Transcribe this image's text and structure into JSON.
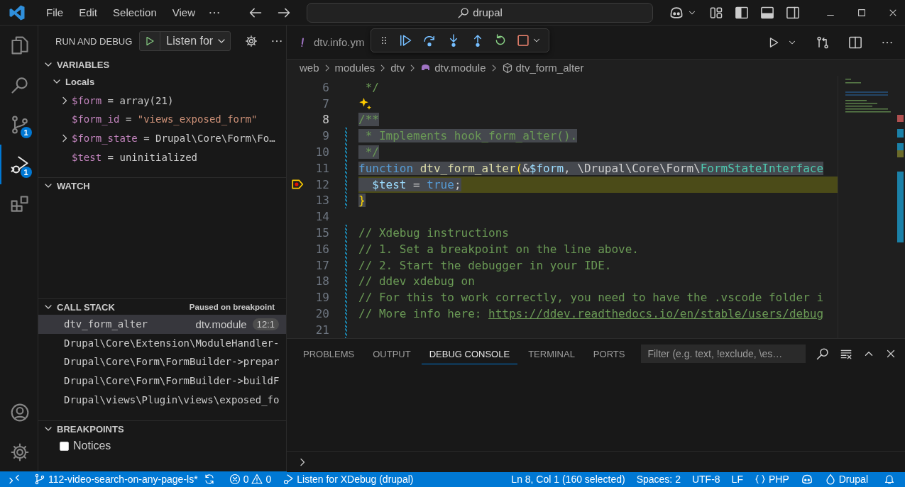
{
  "title_bar": {
    "menus": [
      "File",
      "Edit",
      "Selection",
      "View"
    ],
    "command_center": "drupal"
  },
  "activity_bar": {
    "items": [
      {
        "kind": "explorer",
        "selected": false
      },
      {
        "kind": "search",
        "selected": false
      },
      {
        "kind": "source-control",
        "selected": false,
        "badge": "1"
      },
      {
        "kind": "run-debug",
        "selected": true,
        "badge": "1"
      },
      {
        "kind": "extensions",
        "selected": false
      }
    ],
    "bottom": [
      {
        "kind": "account"
      },
      {
        "kind": "manage"
      }
    ]
  },
  "sidebar": {
    "title": "RUN AND DEBUG",
    "config": "Listen for",
    "variables": {
      "title": "VARIABLES",
      "expanded": true,
      "scope": "Locals",
      "vars": [
        {
          "name": "$form",
          "op": "=",
          "value": "array(21)",
          "expandable": true,
          "kind": "plain"
        },
        {
          "name": "$form_id",
          "op": "=",
          "value": "\"views_exposed_form\"",
          "expandable": false,
          "kind": "string"
        },
        {
          "name": "$form_state",
          "op": "=",
          "value": "Drupal\\Core\\Form\\Fo…",
          "expandable": true,
          "kind": "plain"
        },
        {
          "name": "$test",
          "op": "=",
          "value": "uninitialized",
          "expandable": false,
          "kind": "plain"
        }
      ]
    },
    "watch": {
      "title": "WATCH",
      "expanded": true
    },
    "call_stack": {
      "title": "CALL STACK",
      "status": "Paused on breakpoint",
      "frames": [
        {
          "name": "dtv_form_alter",
          "file": "dtv.module",
          "position": "12:1",
          "selected": true
        },
        {
          "name": "Drupal\\Core\\Extension\\ModuleHandler-",
          "selected": false
        },
        {
          "name": "Drupal\\Core\\Form\\FormBuilder->prepar",
          "selected": false
        },
        {
          "name": "Drupal\\Core\\Form\\FormBuilder->buildF",
          "selected": false
        },
        {
          "name": "Drupal\\views\\Plugin\\views\\exposed_fo",
          "selected": false
        }
      ]
    },
    "breakpoints": {
      "title": "BREAKPOINTS",
      "items": [
        {
          "label": "Notices",
          "checked": false
        }
      ]
    }
  },
  "editor": {
    "tabs": [
      {
        "label": "dtv.info.ym",
        "selected": false
      }
    ],
    "breadcrumbs": [
      {
        "label": "web",
        "kind": "folder"
      },
      {
        "label": "modules",
        "kind": "folder"
      },
      {
        "label": "dtv",
        "kind": "folder"
      },
      {
        "label": "dtv.module",
        "kind": "file"
      },
      {
        "label": "dtv_form_alter",
        "kind": "function"
      }
    ],
    "lines": [
      {
        "number": "6",
        "tokens": [
          {
            "t": " */",
            "kind": "comment"
          }
        ],
        "selected": false,
        "cursor": false,
        "modified": false,
        "paused": false,
        "hint": false
      },
      {
        "number": "7",
        "selected": false,
        "cursor": false,
        "modified": false,
        "paused": false,
        "hint": true
      },
      {
        "number": "8",
        "tokens": [
          {
            "t": "/**",
            "kind": "comment"
          }
        ],
        "selected": true,
        "cursor": true,
        "modified": false,
        "paused": false,
        "hint": false
      },
      {
        "number": "9",
        "tokens": [
          {
            "t": " * Implements hook_form_alter().",
            "kind": "comment"
          }
        ],
        "selected": true,
        "cursor": false,
        "modified": true,
        "paused": false,
        "hint": false
      },
      {
        "number": "10",
        "tokens": [
          {
            "t": " */",
            "kind": "comment"
          }
        ],
        "selected": true,
        "cursor": false,
        "modified": true,
        "paused": false,
        "hint": false
      },
      {
        "number": "11",
        "tokens": [
          {
            "t": "function ",
            "kind": "keyword"
          },
          {
            "t": "dtv_form_alter",
            "kind": "func"
          },
          {
            "t": "(",
            "kind": "bracket"
          },
          {
            "t": "&",
            "kind": "plain"
          },
          {
            "t": "$form",
            "kind": "var"
          },
          {
            "t": ", \\Drupal\\Core\\Form\\",
            "kind": "plain"
          },
          {
            "t": "FormStateInterface",
            "kind": "type"
          }
        ],
        "selected": true,
        "cursor": false,
        "modified": true,
        "paused": false,
        "hint": false
      },
      {
        "number": "12",
        "tokens": [
          {
            "t": "  $test",
            "kind": "var"
          },
          {
            "t": " = ",
            "kind": "plain"
          },
          {
            "t": "true",
            "kind": "keyword"
          },
          {
            "t": ";",
            "kind": "plain"
          }
        ],
        "selected": true,
        "cursor": false,
        "modified": true,
        "paused": true,
        "hint": false
      },
      {
        "number": "13",
        "tokens": [
          {
            "t": "}",
            "kind": "bracket"
          }
        ],
        "selected": true,
        "cursor": false,
        "modified": true,
        "paused": false,
        "hint": false
      },
      {
        "number": "14",
        "selected": false,
        "cursor": false,
        "modified": false,
        "paused": false,
        "hint": false
      },
      {
        "number": "15",
        "tokens": [
          {
            "t": "// Xdebug instructions",
            "kind": "comment"
          }
        ],
        "selected": false,
        "cursor": false,
        "modified": true,
        "paused": false,
        "hint": false
      },
      {
        "number": "16",
        "tokens": [
          {
            "t": "// 1. Set a breakpoint on the line above.",
            "kind": "comment"
          }
        ],
        "selected": false,
        "cursor": false,
        "modified": true,
        "paused": false,
        "hint": false
      },
      {
        "number": "17",
        "tokens": [
          {
            "t": "// 2. Start the debugger in your IDE.",
            "kind": "comment"
          }
        ],
        "selected": false,
        "cursor": false,
        "modified": true,
        "paused": false,
        "hint": false
      },
      {
        "number": "18",
        "tokens": [
          {
            "t": "// ddev xdebug on",
            "kind": "comment"
          }
        ],
        "selected": false,
        "cursor": false,
        "modified": true,
        "paused": false,
        "hint": false
      },
      {
        "number": "19",
        "tokens": [
          {
            "t": "// For this to work correctly, you need to have the .vscode folder i",
            "kind": "comment"
          }
        ],
        "selected": false,
        "cursor": false,
        "modified": true,
        "paused": false,
        "hint": false
      },
      {
        "number": "20",
        "tokens": [
          {
            "t": "// More info here: ",
            "kind": "comment"
          },
          {
            "t": "https://ddev.readthedocs.io/en/stable/users/debug",
            "kind": "link"
          }
        ],
        "selected": false,
        "cursor": false,
        "modified": true,
        "paused": false,
        "hint": false
      },
      {
        "number": "21",
        "selected": false,
        "cursor": false,
        "modified": true,
        "paused": false,
        "hint": false
      }
    ]
  },
  "panel": {
    "tabs": [
      {
        "label": "PROBLEMS",
        "selected": false
      },
      {
        "label": "OUTPUT",
        "selected": false
      },
      {
        "label": "DEBUG CONSOLE",
        "selected": true
      },
      {
        "label": "TERMINAL",
        "selected": false
      },
      {
        "label": "PORTS",
        "selected": false
      }
    ],
    "filter": {
      "placeholder": "Filter (e.g. text, !exclude, \\es…"
    }
  },
  "status_bar": {
    "branch": "112-video-search-on-any-page-ls*",
    "errors": "0",
    "warnings": "0",
    "debug_config": "Listen for XDebug (drupal)",
    "cursor": "Ln 8, Col 1 (160 selected)",
    "indent": "Spaces: 2",
    "encoding": "UTF-8",
    "eol": "LF",
    "language": "PHP",
    "profile": "Drupal"
  }
}
